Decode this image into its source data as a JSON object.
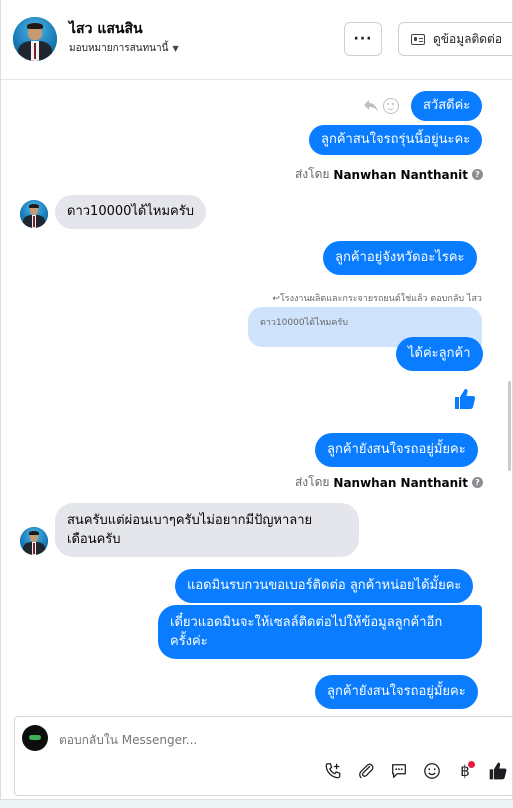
{
  "header": {
    "name": "ไสว แสนสิน",
    "assign_label": "มอบหมายการสนทนานี้",
    "more_label": "···",
    "contact_label": "ดูข้อมูลติดต่อ"
  },
  "messages": {
    "m1": "สวัสดีค่ะ",
    "m2": "ลูกค้าสนใจรถรุ่นนี้อยู่นะคะ",
    "sent_by_1_prefix": "ส่งโดย",
    "sent_by_1_name": "Nanwhan Nanthanit",
    "m3": "ดาว10000ได้ไหมครับ",
    "m4": "ลูกค้าอยู่จังหวัดอะไรคะ",
    "reply_hint": "↩โรงงานผลิตและกระจายรถยนต์ใช่แล้ว ตอบกลับ ไสว",
    "quoted_text": "ดาว10000ได้ไหมครับ",
    "m5": "ได้ค่ะลูกค้า",
    "m6": "ลูกค้ายังสนใจรถอยู่มั้ยคะ",
    "sent_by_2_prefix": "ส่งโดย",
    "sent_by_2_name": "Nanwhan Nanthanit",
    "m7_line1": "สนครับแต่ผ่อนเบาๆครับไม่อยากมีปัญหาลาย",
    "m7_line2": "เดือนครับ",
    "m8": "แอดมินรบกวนขอเบอร์ติดต่อ ลูกค้าหน่อยได้มั้ยคะ",
    "m9_line1": "เดี๋ยวแอดมินจะให้เซลล์ติดต่อไปให้ข้อมูลลูกค้าอีก",
    "m9_line2": "ครั้งค่ะ",
    "m10": "ลูกค้ายังสนใจรถอยู่มั้ยคะ"
  },
  "composer": {
    "placeholder": "ตอบกลับใน Messenger..."
  },
  "colors": {
    "outgoing_bubble": "#0a7cff",
    "incoming_bubble": "#e4e6eb",
    "quoted_bubble": "#cfe3fc",
    "notification_dot": "#e41e3f"
  },
  "icons": [
    "more-icon",
    "contact-card-icon",
    "reply-icon",
    "emoji-reaction-icon",
    "help-icon",
    "thumbs-up-icon",
    "call-add-icon",
    "attach-icon",
    "chat-bubble-icon",
    "emoji-icon",
    "baht-payment-icon"
  ]
}
